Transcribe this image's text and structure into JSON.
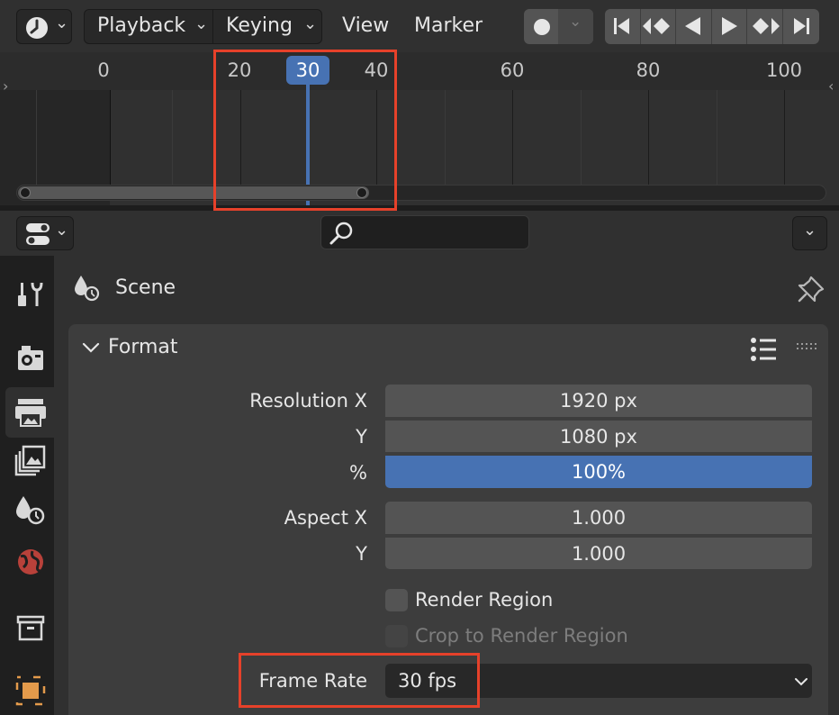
{
  "timeline": {
    "menus": {
      "playback": "Playback",
      "keying": "Keying",
      "view": "View",
      "marker": "Marker"
    },
    "chevron": "⌄",
    "ruler_ticks": [
      "0",
      "20",
      "30",
      "40",
      "60",
      "80",
      "100"
    ],
    "current_frame": "30",
    "transport_icons": [
      "jump-start-icon",
      "prev-keyframe-icon",
      "play-reverse-icon",
      "play-icon",
      "next-keyframe-icon",
      "jump-end-icon"
    ],
    "accent_color": "#4772b3",
    "highlight_color": "#e6412a"
  },
  "properties": {
    "context_label": "Scene",
    "tabs": [
      "tool-tab",
      "render-tab",
      "output-tab",
      "view-layer-tab",
      "scene-tab",
      "world-tab",
      "collection-tab",
      "object-tab"
    ],
    "active_tab": "output-tab",
    "format_panel": {
      "title": "Format",
      "resolution_x_label": "Resolution X",
      "resolution_x": "1920 px",
      "resolution_y_label": "Y",
      "resolution_y": "1080 px",
      "percent_label": "%",
      "percent": "100%",
      "aspect_x_label": "Aspect X",
      "aspect_x": "1.000",
      "aspect_y_label": "Y",
      "aspect_y": "1.000",
      "render_region_label": "Render Region",
      "crop_label": "Crop to Render Region",
      "frame_rate_label": "Frame Rate",
      "frame_rate": "30 fps"
    }
  }
}
